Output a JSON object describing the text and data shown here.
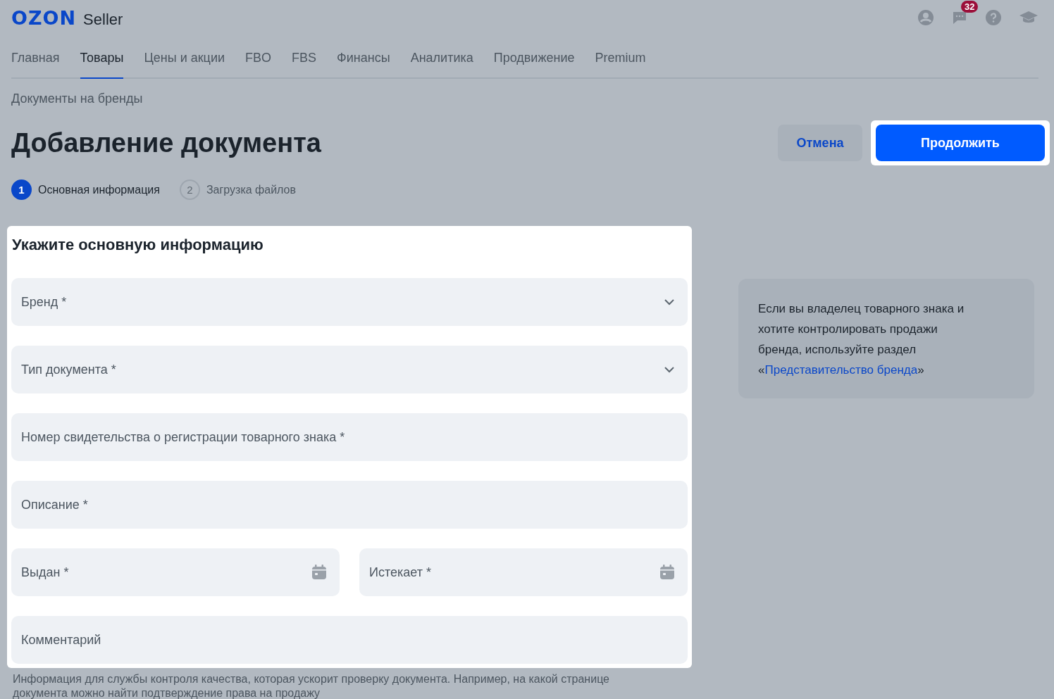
{
  "header": {
    "logo": "OZON",
    "product": "Seller",
    "notifications_badge": "32"
  },
  "tabs": [
    {
      "label": "Главная",
      "selected": false
    },
    {
      "label": "Товары",
      "selected": true
    },
    {
      "label": "Цены и акции",
      "selected": false
    },
    {
      "label": "FBO",
      "selected": false
    },
    {
      "label": "FBS",
      "selected": false
    },
    {
      "label": "Финансы",
      "selected": false
    },
    {
      "label": "Аналитика",
      "selected": false
    },
    {
      "label": "Продвижение",
      "selected": false
    },
    {
      "label": "Premium",
      "selected": false
    }
  ],
  "breadcrumb": "Документы на бренды",
  "title": "Добавление документа",
  "buttons": {
    "cancel": "Отмена",
    "continue": "Продолжить"
  },
  "steps": [
    {
      "number": "1",
      "label": "Основная информация",
      "selected": true
    },
    {
      "number": "2",
      "label": "Загрузка файлов",
      "selected": false
    }
  ],
  "form": {
    "title": "Укажите основную информацию",
    "fields": [
      {
        "kind": "select",
        "placeholder": "Бренд *"
      },
      {
        "kind": "select",
        "placeholder": "Тип документа *"
      },
      {
        "kind": "text",
        "placeholder": "Номер свидетельства о регистрации товарного знака *"
      },
      {
        "kind": "text",
        "placeholder": "Описание *"
      },
      {
        "kind": "date",
        "placeholder": "Выдан *"
      },
      {
        "kind": "date",
        "placeholder": "Истекает *"
      },
      {
        "kind": "text",
        "placeholder": "Комментарий"
      }
    ],
    "hint": "Информация для службы контроля качества, которая ускорит проверку документа. Например, на какой странице документа можно найти подтверждение права на продажу"
  },
  "info": {
    "text": "Если вы владелец товарного знака и хотите контролировать продажи бренда, используйте раздел «",
    "link": "Представительство бренда",
    "text_end": "»"
  }
}
